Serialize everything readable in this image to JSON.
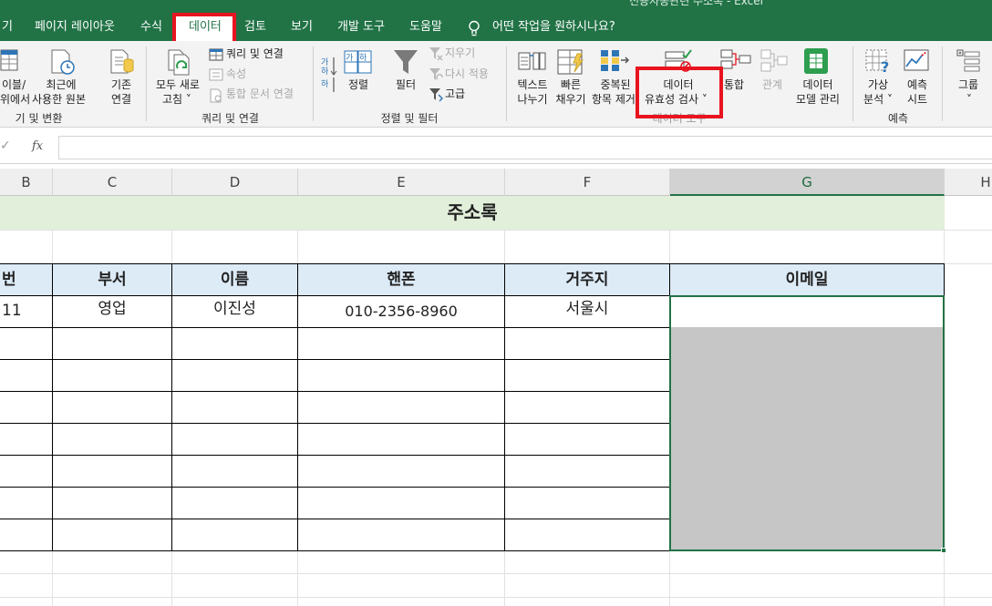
{
  "window": {
    "title": "전용자동관련 주소록 - Excel"
  },
  "tabs": [
    {
      "id": "home",
      "label": "기"
    },
    {
      "id": "layout",
      "label": "페이지 레이아웃"
    },
    {
      "id": "formula",
      "label": "수식"
    },
    {
      "id": "data",
      "label": "데이터"
    },
    {
      "id": "review",
      "label": "검토"
    },
    {
      "id": "view",
      "label": "보기"
    },
    {
      "id": "dev",
      "label": "개발 도구"
    },
    {
      "id": "help",
      "label": "도움말"
    }
  ],
  "tell_me": "어떤 작업을 원하시나요?",
  "ribbon": {
    "get_transform": {
      "table_label": [
        "이블/",
        "위에서"
      ],
      "recent_label": [
        "최근에",
        "사용한 원본"
      ],
      "existing_label": [
        "기존",
        "연결"
      ],
      "group": "기 및 변환"
    },
    "queries": {
      "refresh_label": [
        "모두 새로",
        "고침 ˅"
      ],
      "queries_connections": "쿼리 및 연결",
      "properties": "속성",
      "edit_links": "통합 문서 연결",
      "group": "쿼리 및 연결"
    },
    "sort_filter": {
      "sort": "정렬",
      "filter": "필터",
      "clear": "지우기",
      "reapply": "다시 적용",
      "advanced": "고급",
      "group": "정렬 및 필터"
    },
    "data_tools": {
      "text_to_col": [
        "텍스트",
        "나누기"
      ],
      "flash_fill": [
        "빠른",
        "채우기"
      ],
      "remove_dup": [
        "중복된",
        "항목 제거"
      ],
      "validation": [
        "데이터",
        "유효성 검사 ˅"
      ],
      "consolidate": "통합",
      "relationships": "관계",
      "data_model": [
        "데이터",
        "모델 관리"
      ],
      "group": "데이터 도구"
    },
    "forecast": {
      "whatif": [
        "가상",
        "분석 ˅"
      ],
      "forecast_sheet": [
        "예측",
        "시트"
      ],
      "group": "예측"
    },
    "outline": {
      "group_label": [
        "그룹",
        "˅"
      ]
    }
  },
  "formula_bar": {
    "fx": "fx",
    "content": ""
  },
  "columns": [
    "B",
    "C",
    "D",
    "E",
    "F",
    "G",
    "H"
  ],
  "sheet": {
    "title": "주소록",
    "headers": [
      "번",
      "부서",
      "이름",
      "핸폰",
      "거주지",
      "이메일"
    ],
    "rows": [
      [
        "11",
        "영업",
        "이진성",
        "010-2356-8960",
        "서울시",
        ""
      ]
    ]
  },
  "colors": {
    "excel_green": "#217346",
    "highlight_red": "#e8141f",
    "title_fill": "#e2efda",
    "header_fill": "#ddebf7",
    "selection_fill": "#c6c6c6"
  }
}
